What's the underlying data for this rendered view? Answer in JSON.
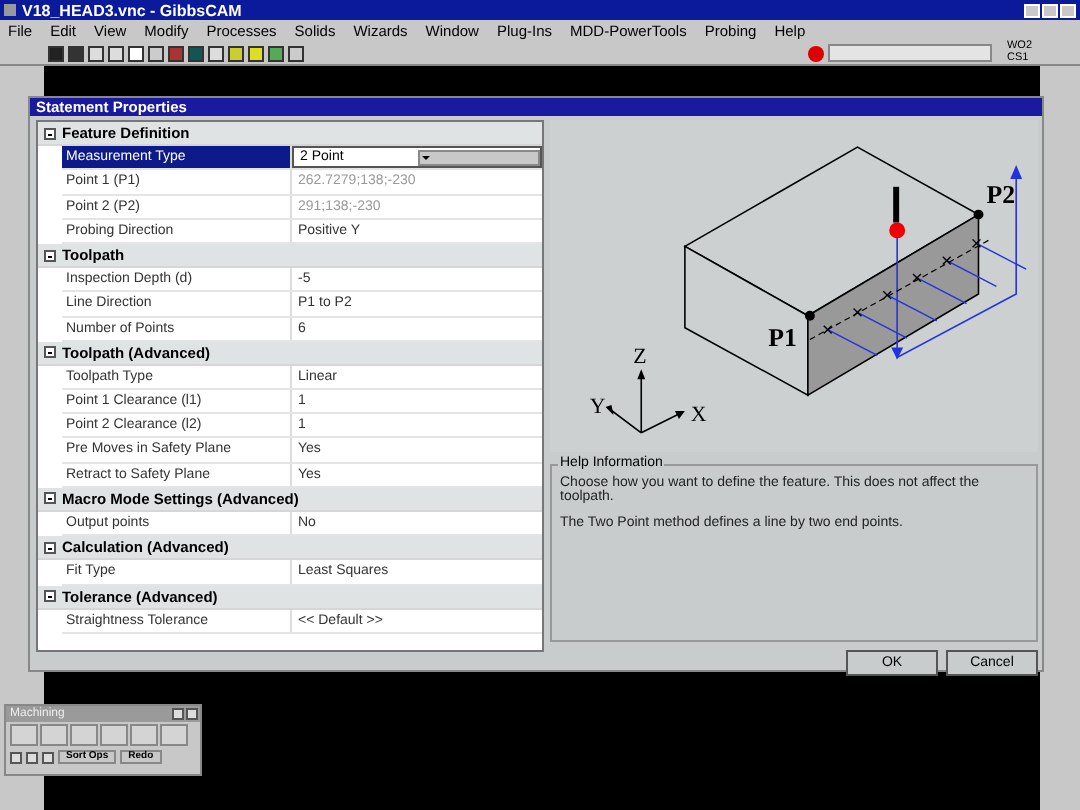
{
  "window": {
    "title": "V18_HEAD3.vnc - GibbsCAM"
  },
  "menu": [
    "File",
    "Edit",
    "View",
    "Modify",
    "Processes",
    "Solids",
    "Wizards",
    "Window",
    "Plug-Ins",
    "MDD-PowerTools",
    "Probing",
    "Help"
  ],
  "coordinate_indicator": [
    "WO2",
    "CS1"
  ],
  "dialog": {
    "title": "Statement Properties",
    "sections": [
      {
        "title": "Feature Definition",
        "expanded": true,
        "rows": [
          {
            "label": "Measurement Type",
            "value": "2 Point",
            "kind": "dropdown",
            "selected": true,
            "disabled": false
          },
          {
            "label": "Point 1 (P1)",
            "value": "262.7279;138;-230",
            "kind": "text",
            "selected": false,
            "disabled": true
          },
          {
            "label": "Point 2 (P2)",
            "value": "291;138;-230",
            "kind": "text",
            "selected": false,
            "disabled": true
          },
          {
            "label": "Probing Direction",
            "value": "Positive Y",
            "kind": "text",
            "selected": false,
            "disabled": false
          }
        ]
      },
      {
        "title": "Toolpath",
        "expanded": true,
        "rows": [
          {
            "label": "Inspection Depth (d)",
            "value": "-5",
            "kind": "text",
            "selected": false,
            "disabled": false
          },
          {
            "label": "Line Direction",
            "value": "P1 to P2",
            "kind": "text",
            "selected": false,
            "disabled": false
          },
          {
            "label": "Number of Points",
            "value": "6",
            "kind": "text",
            "selected": false,
            "disabled": false
          }
        ]
      },
      {
        "title": "Toolpath (Advanced)",
        "expanded": true,
        "rows": [
          {
            "label": "Toolpath Type",
            "value": "Linear",
            "kind": "text",
            "selected": false,
            "disabled": false
          },
          {
            "label": "Point 1 Clearance (l1)",
            "value": "1",
            "kind": "text",
            "selected": false,
            "disabled": false
          },
          {
            "label": "Point 2 Clearance (l2)",
            "value": "1",
            "kind": "text",
            "selected": false,
            "disabled": false
          },
          {
            "label": "Pre Moves in Safety Plane",
            "value": "Yes",
            "kind": "text",
            "selected": false,
            "disabled": false
          },
          {
            "label": "Retract to Safety Plane",
            "value": "Yes",
            "kind": "text",
            "selected": false,
            "disabled": false
          }
        ]
      },
      {
        "title": "Macro Mode Settings (Advanced)",
        "expanded": true,
        "rows": [
          {
            "label": "Output points",
            "value": "No",
            "kind": "text",
            "selected": false,
            "disabled": false
          }
        ]
      },
      {
        "title": "Calculation (Advanced)",
        "expanded": true,
        "rows": [
          {
            "label": "Fit Type",
            "value": "Least Squares",
            "kind": "text",
            "selected": false,
            "disabled": false
          }
        ]
      },
      {
        "title": "Tolerance (Advanced)",
        "expanded": true,
        "rows": [
          {
            "label": "Straightness Tolerance",
            "value": "<< Default >>",
            "kind": "text",
            "selected": false,
            "disabled": false
          }
        ]
      }
    ],
    "diagram": {
      "labels": [
        "P1",
        "P2",
        "X",
        "Y",
        "Z"
      ]
    },
    "help": {
      "title": "Help Information",
      "paragraphs": [
        "Choose how you want to define the feature. This does not affect the toolpath.",
        "The Two Point method defines a line by two end points."
      ]
    },
    "buttons": [
      "OK",
      "Cancel"
    ]
  },
  "palette": {
    "title": "Machining",
    "buttons": [
      "Sort Ops",
      "Redo"
    ]
  }
}
